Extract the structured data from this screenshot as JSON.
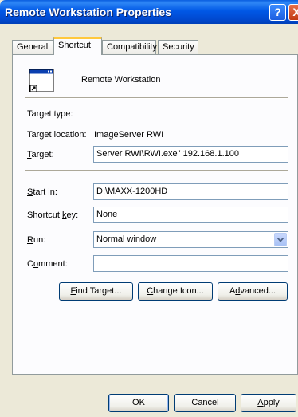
{
  "window": {
    "title": "Remote Workstation Properties"
  },
  "titlebar": {
    "help_label": "?",
    "close_label": "X"
  },
  "tabs": [
    {
      "label": "General"
    },
    {
      "label": "Shortcut"
    },
    {
      "label": "Compatibility"
    },
    {
      "label": "Security"
    }
  ],
  "shortcut": {
    "name": "Remote Workstation",
    "target_type_label": "Target type:",
    "target_type_value": "",
    "target_location_label": "Target location:",
    "target_location_value": "ImageServer RWI",
    "target_label": {
      "pre": "",
      "key": "T",
      "post": "arget:"
    },
    "target_value": "Server RWI\\RWI.exe\" 192.168.1.100",
    "start_in_label": {
      "pre": "",
      "key": "S",
      "post": "tart in:"
    },
    "start_in_value": "D:\\MAXX-1200HD",
    "shortcut_key_label": {
      "pre": "Shortcut ",
      "key": "k",
      "post": "ey:"
    },
    "shortcut_key_value": "None",
    "run_label": {
      "pre": "",
      "key": "R",
      "post": "un:"
    },
    "run_value": "Normal window",
    "comment_label": {
      "pre": "C",
      "key": "o",
      "post": "mment:"
    },
    "comment_value": "",
    "find_target": {
      "pre": "",
      "key": "F",
      "post": "ind Target..."
    },
    "change_icon": {
      "pre": "",
      "key": "C",
      "post": "hange Icon..."
    },
    "advanced": {
      "pre": "A",
      "key": "d",
      "post": "vanced..."
    }
  },
  "footer": {
    "ok": "OK",
    "cancel": "Cancel",
    "apply": {
      "pre": "",
      "key": "A",
      "post": "pply"
    }
  },
  "icons": {
    "window": "close-icon",
    "help": "help-icon",
    "shortcut": "program-window-icon",
    "dropdown": "chevron-down-icon"
  },
  "colors": {
    "titlebar": "#0054e3",
    "dialog_bg": "#ece9d8",
    "tab_accent": "#ffc83c",
    "field_border": "#7f9db9"
  }
}
